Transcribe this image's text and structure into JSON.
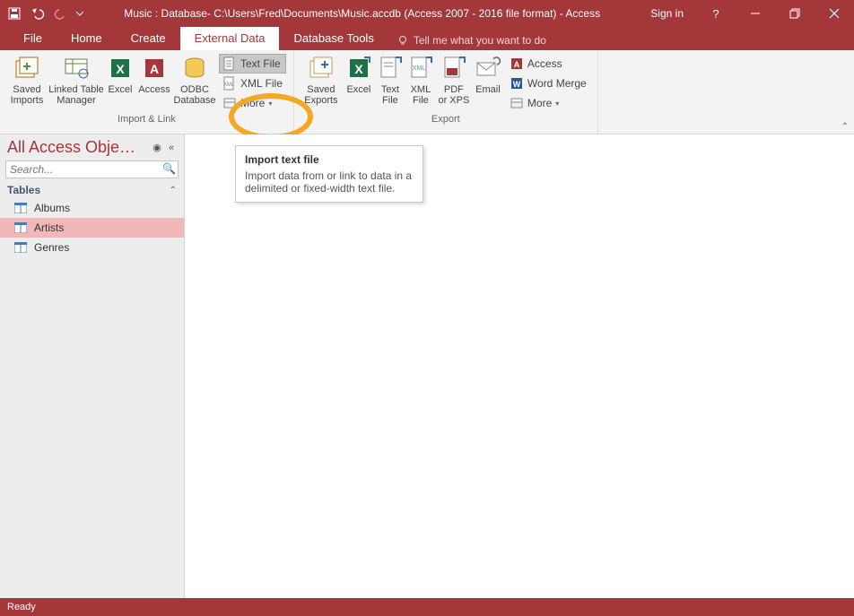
{
  "title": "Music : Database- C:\\Users\\Fred\\Documents\\Music.accdb (Access 2007 - 2016 file format) - Access",
  "signin": "Sign in",
  "tabs": {
    "file": "File",
    "home": "Home",
    "create": "Create",
    "external": "External Data",
    "dbtools": "Database Tools",
    "tellme": "Tell me what you want to do"
  },
  "ribbon": {
    "import_group": "Import & Link",
    "export_group": "Export",
    "saved_imports": "Saved\nImports",
    "linked_table": "Linked Table\nManager",
    "excel": "Excel",
    "access": "Access",
    "odbc": "ODBC\nDatabase",
    "text_file": "Text File",
    "xml_file": "XML File",
    "more": "More",
    "saved_exports": "Saved\nExports",
    "excel2": "Excel",
    "text_file2": "Text\nFile",
    "xml_file2": "XML\nFile",
    "pdf_xps": "PDF\nor XPS",
    "email": "Email",
    "e_access": "Access",
    "e_wordmerge": "Word Merge",
    "e_more": "More"
  },
  "nav": {
    "title": "All Access Obje…",
    "search_placeholder": "Search...",
    "group": "Tables",
    "items": [
      "Albums",
      "Artists",
      "Genres"
    ],
    "selected": 1
  },
  "tooltip": {
    "title": "Import text file",
    "body": "Import data from or link to data in a delimited or fixed-width text file."
  },
  "status": "Ready"
}
